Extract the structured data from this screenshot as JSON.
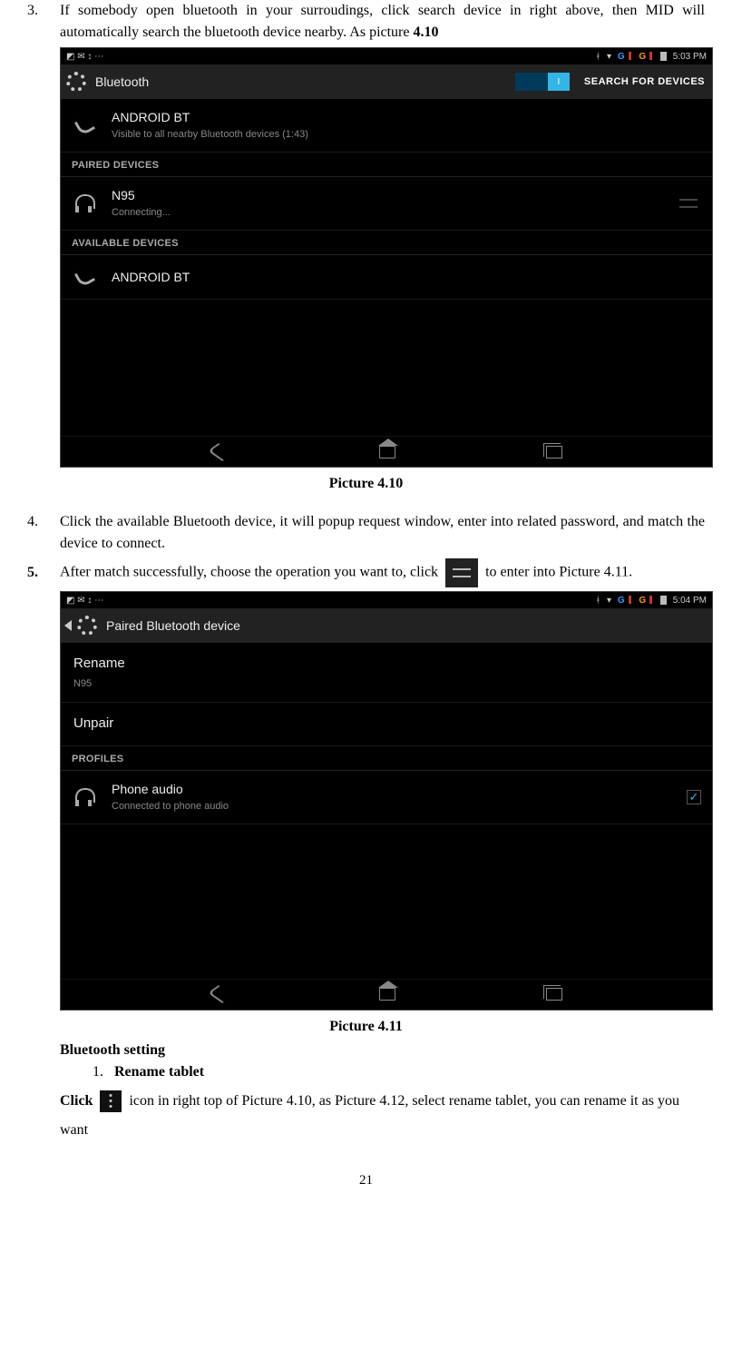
{
  "item3": {
    "num": "3.",
    "text": "If somebody open bluetooth in your surroudings, click search device in right above, then MID will automatically search the bluetooth device nearby. As picture ",
    "ref": "4.10"
  },
  "shot1": {
    "status_left_icons": "◩ ✉ ↕ ⋯",
    "status_time": "5:03 PM",
    "title": "Bluetooth",
    "toggle_on": "I",
    "search_label": "SEARCH FOR DEVICES",
    "my": {
      "name": "ANDROID BT",
      "sub": "Visible to all nearby Bluetooth devices (1:43)"
    },
    "hdr_paired": "PAIRED DEVICES",
    "paired": {
      "name": "N95",
      "sub": "Connecting..."
    },
    "hdr_avail": "AVAILABLE DEVICES",
    "avail": {
      "name": "ANDROID BT"
    }
  },
  "cap1": "Picture 4.10",
  "item4": {
    "num": "4.",
    "text": "Click the available Bluetooth device, it will popup request window, enter into related password, and match the device to connect."
  },
  "item5": {
    "num": "5.",
    "text_a": "After match successfully, choose the operation you want to, click ",
    "text_b": " to enter into Picture 4.11."
  },
  "shot2": {
    "status_left_icons": "◩ ✉ ↕ ⋯",
    "status_time": "5:04 PM",
    "title": "Paired Bluetooth device",
    "rename": {
      "label": "Rename",
      "sub": "N95"
    },
    "unpair": "Unpair",
    "hdr_profiles": "PROFILES",
    "profile": {
      "name": "Phone audio",
      "sub": "Connected to phone audio"
    }
  },
  "cap2": "Picture 4.11",
  "bt_setting_hdr": "Bluetooth setting",
  "rename_item": {
    "num": "1.",
    "label": "Rename tablet"
  },
  "rename_para_a": "Click ",
  "rename_para_b": " icon in right top of Picture 4.10, as Picture 4.12, select rename tablet, you can rename it as you want",
  "page_number": "21"
}
